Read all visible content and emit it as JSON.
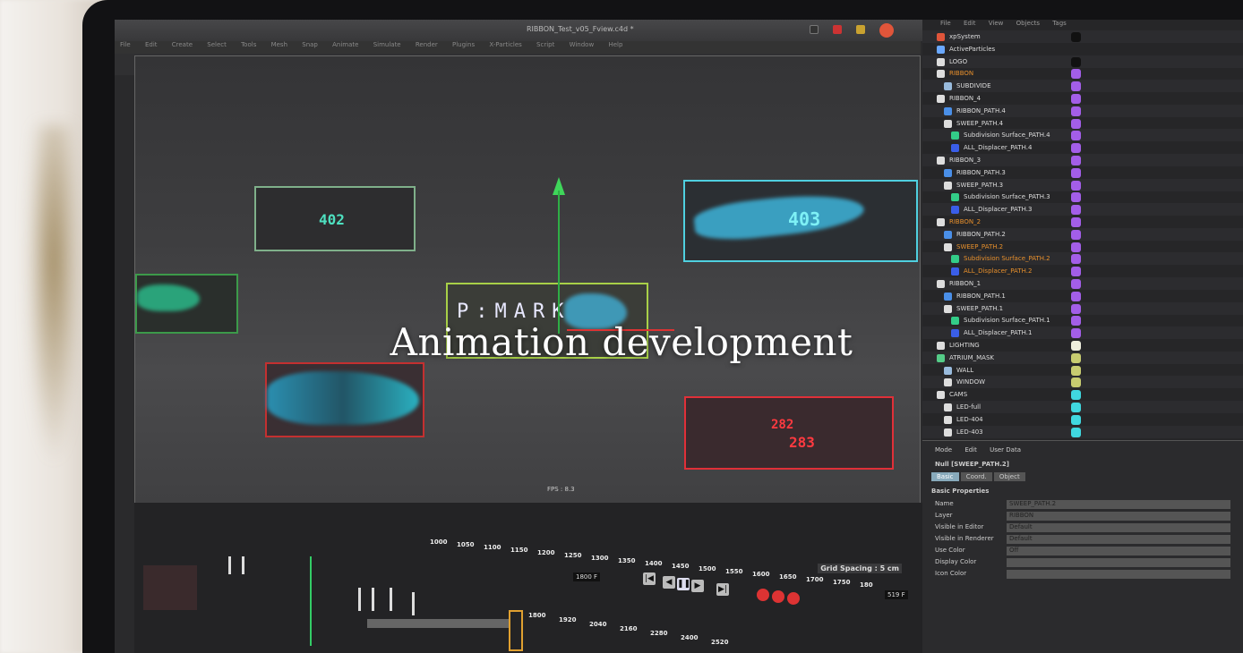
{
  "caption": "Animation development",
  "app": {
    "window_title": "RIBBON_Test_v05_Fview.c4d *",
    "menu": [
      "File",
      "Edit",
      "Create",
      "Select",
      "Tools",
      "Mesh",
      "Snap",
      "Animate",
      "Simulate",
      "Render",
      "Plugins",
      "X-Particles",
      "Script",
      "Window",
      "Help"
    ]
  },
  "viewport": {
    "labels": {
      "box_402": "402",
      "box_403": "403",
      "center": "P:MARK",
      "red_a": "282",
      "red_b": "283"
    },
    "grid_spacing": "Grid Spacing : 5 cm",
    "fps_label": "FPS : 8.3"
  },
  "object_manager": {
    "menu": [
      "File",
      "Edit",
      "View",
      "Objects",
      "Tags"
    ],
    "objects": [
      {
        "name": "xpSystem",
        "icon": "#e0553a",
        "tag": "#111"
      },
      {
        "name": "ActiveParticles",
        "icon": "#6aa8ff",
        "tag": ""
      },
      {
        "name": "LOGO",
        "icon": "#ddd",
        "tag": "#111"
      },
      {
        "name": "RIBBON",
        "icon": "#ddd",
        "tag": "#a35ee8",
        "orange": true
      },
      {
        "name": "SUBDIVIDE",
        "icon": "#9bd",
        "tag": "#a35ee8"
      },
      {
        "name": "RIBBON_4",
        "icon": "#ddd",
        "tag": "#a35ee8"
      },
      {
        "name": "RIBBON_PATH.4",
        "icon": "#4a8fe8",
        "tag": "#a35ee8"
      },
      {
        "name": "SWEEP_PATH.4",
        "icon": "#ddd",
        "tag": "#a35ee8"
      },
      {
        "name": "Subdivision Surface_PATH.4",
        "icon": "#33cc88",
        "tag": "#a35ee8"
      },
      {
        "name": "ALL_Displacer_PATH.4",
        "icon": "#3a5ee8",
        "tag": "#a35ee8"
      },
      {
        "name": "RIBBON_3",
        "icon": "#ddd",
        "tag": "#a35ee8"
      },
      {
        "name": "RIBBON_PATH.3",
        "icon": "#4a8fe8",
        "tag": "#a35ee8"
      },
      {
        "name": "SWEEP_PATH.3",
        "icon": "#ddd",
        "tag": "#a35ee8"
      },
      {
        "name": "Subdivision Surface_PATH.3",
        "icon": "#33cc88",
        "tag": "#a35ee8"
      },
      {
        "name": "ALL_Displacer_PATH.3",
        "icon": "#3a5ee8",
        "tag": "#a35ee8"
      },
      {
        "name": "RIBBON_2",
        "icon": "#ddd",
        "tag": "#a35ee8",
        "orange": true
      },
      {
        "name": "RIBBON_PATH.2",
        "icon": "#4a8fe8",
        "tag": "#a35ee8"
      },
      {
        "name": "SWEEP_PATH.2",
        "icon": "#ddd",
        "tag": "#a35ee8",
        "orange": true
      },
      {
        "name": "Subdivision Surface_PATH.2",
        "icon": "#33cc88",
        "tag": "#a35ee8",
        "orange": true
      },
      {
        "name": "ALL_Displacer_PATH.2",
        "icon": "#3a5ee8",
        "tag": "#a35ee8",
        "orange": true
      },
      {
        "name": "RIBBON_1",
        "icon": "#ddd",
        "tag": "#a35ee8"
      },
      {
        "name": "RIBBON_PATH.1",
        "icon": "#4a8fe8",
        "tag": "#a35ee8"
      },
      {
        "name": "SWEEP_PATH.1",
        "icon": "#ddd",
        "tag": "#a35ee8"
      },
      {
        "name": "Subdivision Surface_PATH.1",
        "icon": "#33cc88",
        "tag": "#a35ee8"
      },
      {
        "name": "ALL_Displacer_PATH.1",
        "icon": "#3a5ee8",
        "tag": "#a35ee8"
      },
      {
        "name": "LIGHTING",
        "icon": "#ddd",
        "tag": "#eeeedd"
      },
      {
        "name": "ATRIUM_MASK",
        "icon": "#55cc88",
        "tag": "#c8cc70"
      },
      {
        "name": "WALL",
        "icon": "#9bd",
        "tag": "#c8cc70"
      },
      {
        "name": "WINDOW",
        "icon": "#ddd",
        "tag": "#c8cc70"
      },
      {
        "name": "CAMS",
        "icon": "#ddd",
        "tag": "#40d8e0"
      },
      {
        "name": "LED-full",
        "icon": "#ddd",
        "tag": "#40d8e0"
      },
      {
        "name": "LED-404",
        "icon": "#ddd",
        "tag": "#40d8e0"
      },
      {
        "name": "LED-403",
        "icon": "#ddd",
        "tag": "#40d8e0"
      }
    ]
  },
  "attributes": {
    "tabs": [
      "Mode",
      "Edit",
      "User Data"
    ],
    "object_title": "Null [SWEEP_PATH.2]",
    "subtabs": [
      "Basic",
      "Coord.",
      "Object"
    ],
    "section": "Basic Properties",
    "fields": [
      {
        "label": "Name",
        "value": "SWEEP_PATH.2"
      },
      {
        "label": "Layer",
        "value": "RIBBON"
      },
      {
        "label": "Visible in Editor",
        "value": "Default"
      },
      {
        "label": "Visible in Renderer",
        "value": "Default"
      },
      {
        "label": "Use Color",
        "value": "Off"
      },
      {
        "label": "Display Color",
        "value": ""
      },
      {
        "label": "Icon Color",
        "value": ""
      }
    ]
  },
  "timeline": {
    "ruler": [
      "1000",
      "1050",
      "1100",
      "1150",
      "1200",
      "1250",
      "1300",
      "1350",
      "1400",
      "1450",
      "1500",
      "1550",
      "1600",
      "1650",
      "1700",
      "1750",
      "180"
    ],
    "ruler2": [
      "1800",
      "1920",
      "2040",
      "2160",
      "2280",
      "2400",
      "2520"
    ],
    "current_frame": "1800 F",
    "end_frame": "519 F"
  }
}
